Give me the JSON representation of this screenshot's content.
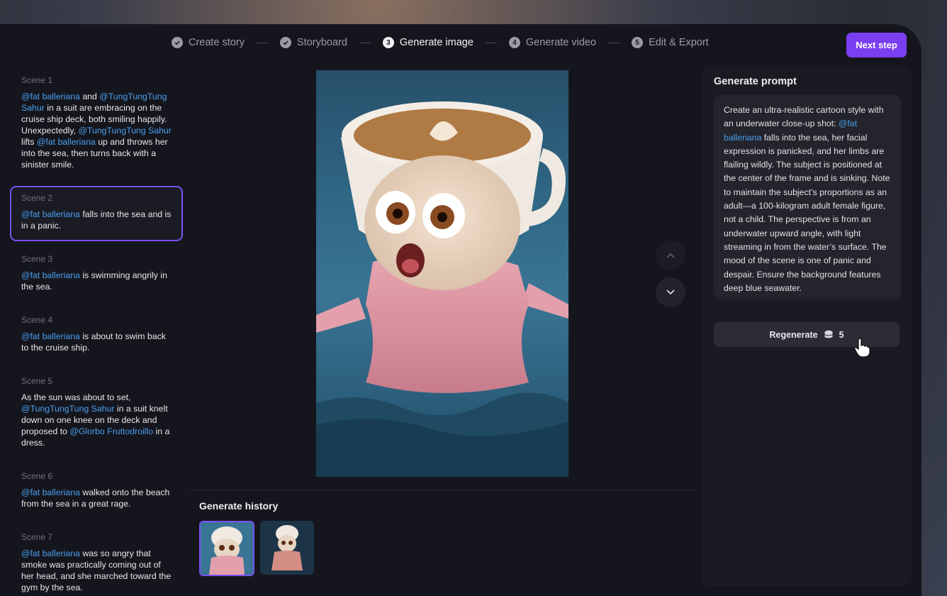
{
  "stepper": {
    "steps": [
      {
        "label": "Create story",
        "state": "done"
      },
      {
        "label": "Storyboard",
        "state": "done"
      },
      {
        "label": "Generate image",
        "state": "current",
        "number": "3"
      },
      {
        "label": "Generate video",
        "state": "upcoming",
        "number": "4"
      },
      {
        "label": "Edit & Export",
        "state": "upcoming",
        "number": "5"
      }
    ],
    "next_label": "Next step"
  },
  "scenes": [
    {
      "title": "Scene 1"
    },
    {
      "title": "Scene 2"
    },
    {
      "title": "Scene 3"
    },
    {
      "title": "Scene 4"
    },
    {
      "title": "Scene 5"
    },
    {
      "title": "Scene 6"
    },
    {
      "title": "Scene 7"
    }
  ],
  "scene_text": {
    "s1": [
      "@fat balleriana",
      " and ",
      "@TungTungTung Sahur",
      " in a suit are embracing on the cruise ship deck, both smiling happily. Unexpectedly, ",
      "@TungTungTung Sahur",
      " lifts ",
      "@fat balleriana",
      " up and throws her into the sea, then turns back with a sinister smile."
    ],
    "s2": [
      "@fat balleriana",
      " falls into the sea and is in a panic."
    ],
    "s3": [
      "@fat balleriana",
      " is swimming angrily in the sea."
    ],
    "s4": [
      "@fat balleriana",
      " is about to swim back to the cruise ship."
    ],
    "s5": [
      "As the sun was about to set, ",
      "@TungTungTung Sahur",
      " in a suit knelt down on one knee on the deck and proposed to ",
      "@Glorbo Fruttodroillo",
      " in a dress."
    ],
    "s6": [
      "@fat balleriana",
      " walked onto the beach from the sea in a great rage."
    ],
    "s7": [
      "@fat balleriana",
      " was so angry that smoke was practically coming out of her head, and she marched toward the gym by the sea."
    ]
  },
  "history_title": "Generate history",
  "panel": {
    "title": "Generate prompt",
    "prompt_parts": [
      "Create an ultra-realistic cartoon style with an underwater close-up shot: ",
      "@fat balleriana",
      " falls into the sea, her facial expression is panicked, and her limbs are flailing wildly. The subject is positioned at the center of the frame and is sinking. Note to maintain the subject’s proportions as an adult—a 100-kilogram adult female figure, not a child. The perspective is from an underwater upward angle, with light streaming in from the water’s surface. The mood of the scene is one of panic and despair. Ensure the background features deep blue seawater."
    ],
    "regen_label": "Regenerate",
    "regen_cost": "5"
  },
  "colors": {
    "accent": "#7b3ff2",
    "mention": "#4a9ff0",
    "background": "#15161d"
  },
  "icons": [
    "check-circle-icon",
    "coins-icon",
    "chevron-up-icon",
    "chevron-down-icon",
    "hand-pointer-icon"
  ]
}
